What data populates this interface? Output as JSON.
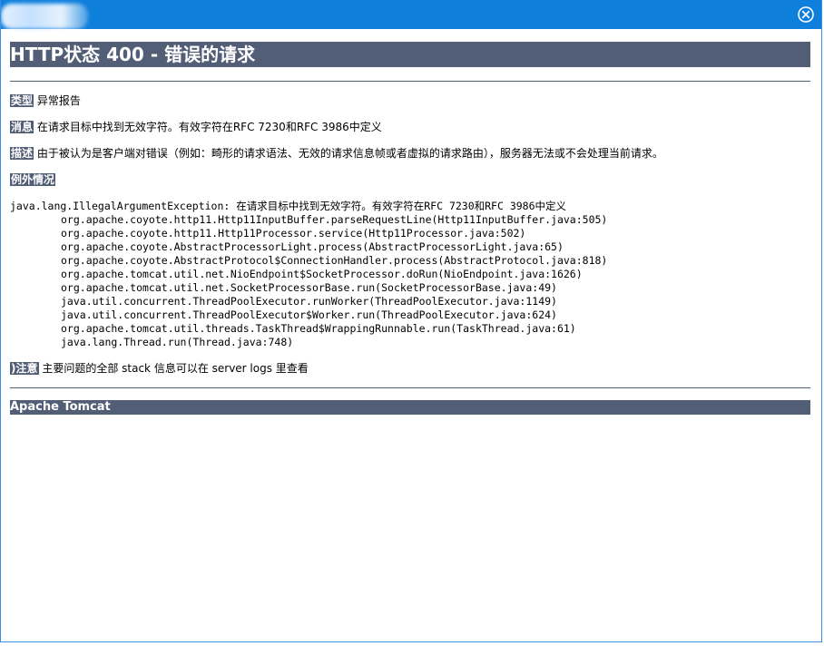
{
  "window": {
    "close_icon": "close-icon",
    "colors": {
      "titlebar": "#0f7fdc",
      "accent_bar": "#525d76",
      "border": "#3a8ee6"
    }
  },
  "page": {
    "title": "HTTP状态 400 - 错误的请求",
    "type_label": "类型",
    "type_value": "异常报告",
    "message_label": "消息",
    "message_value": "在请求目标中找到无效字符。有效字符在RFC 7230和RFC 3986中定义",
    "description_label": "描述",
    "description_value": "由于被认为是客户端对错误（例如：畸形的请求语法、无效的请求信息帧或者虚拟的请求路由），服务器无法或不会处理当前请求。",
    "exception_label": "例外情况",
    "exception_head": "java.lang.IllegalArgumentException: 在请求目标中找到无效字符。有效字符在RFC 7230和RFC 3986中定义",
    "stack": [
      "org.apache.coyote.http11.Http11InputBuffer.parseRequestLine(Http11InputBuffer.java:505)",
      "org.apache.coyote.http11.Http11Processor.service(Http11Processor.java:502)",
      "org.apache.coyote.AbstractProcessorLight.process(AbstractProcessorLight.java:65)",
      "org.apache.coyote.AbstractProtocol$ConnectionHandler.process(AbstractProtocol.java:818)",
      "org.apache.tomcat.util.net.NioEndpoint$SocketProcessor.doRun(NioEndpoint.java:1626)",
      "org.apache.tomcat.util.net.SocketProcessorBase.run(SocketProcessorBase.java:49)",
      "java.util.concurrent.ThreadPoolExecutor.runWorker(ThreadPoolExecutor.java:1149)",
      "java.util.concurrent.ThreadPoolExecutor$Worker.run(ThreadPoolExecutor.java:624)",
      "org.apache.tomcat.util.threads.TaskThread$WrappingRunnable.run(TaskThread.java:61)",
      "java.lang.Thread.run(Thread.java:748)"
    ],
    "note_label": ")注意",
    "note_value": "主要问题的全部 stack 信息可以在 server logs 里查看",
    "footer": "Apache Tomcat"
  }
}
